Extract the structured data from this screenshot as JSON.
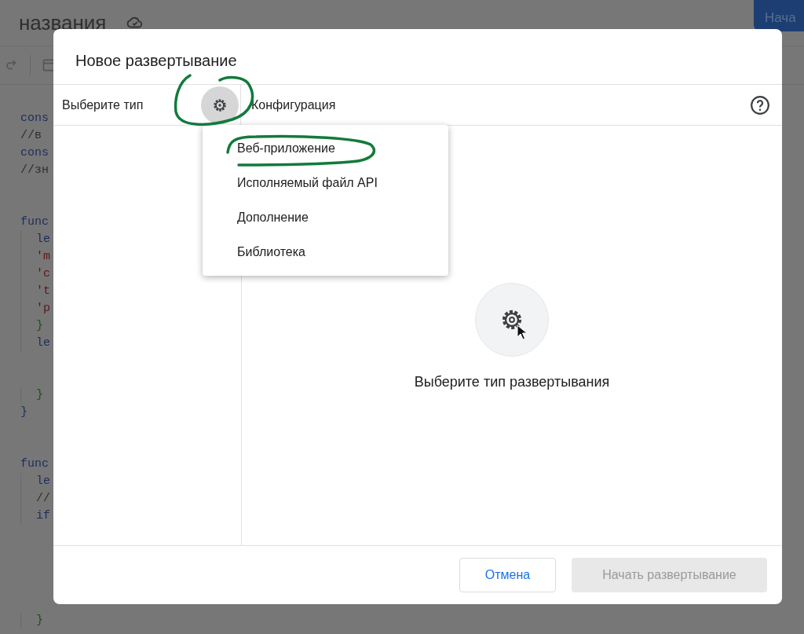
{
  "background": {
    "title": "названия",
    "primary_button": "Нача",
    "code_blocks": [
      [
        {
          "text": "cons",
          "kind": "keyword"
        },
        {
          "text": "//в",
          "kind": "comment"
        },
        {
          "text": "cons",
          "kind": "keyword"
        },
        {
          "text": "//зн",
          "kind": "comment"
        }
      ],
      [
        {
          "text": "func",
          "kind": "keyword",
          "children": [
            [
              {
                "text": "le",
                "kind": "keyword"
              },
              {
                "text": "'m",
                "kind": "string"
              },
              {
                "text": "'c",
                "kind": "string"
              },
              {
                "text": "'t",
                "kind": "string"
              },
              {
                "text": "'p",
                "kind": "string"
              },
              {
                "text": "}",
                "kind": "brace"
              },
              {
                "text": "le",
                "kind": "keyword"
              }
            ],
            [
              {
                "text": "}",
                "kind": "brace"
              }
            ]
          ]
        },
        {
          "text": "}",
          "kind": "keyword"
        }
      ],
      [
        {
          "text": "func",
          "kind": "keyword",
          "children": [
            [
              {
                "text": "le",
                "kind": "keyword"
              },
              {
                "text": "//",
                "kind": "comment"
              },
              {
                "text": "if",
                "kind": "keyword"
              }
            ]
          ]
        }
      ]
    ],
    "bottom_lines": [
      {
        "text": "}",
        "kind": "brace"
      }
    ]
  },
  "dialog": {
    "title": "Новое развертывание",
    "left_header": "Выберите тип",
    "right_header": "Конфигурация",
    "menu": [
      {
        "label": "Веб-приложение",
        "selected": false
      },
      {
        "label": "Исполняемый файл API",
        "selected": false
      },
      {
        "label": "Дополнение",
        "selected": false
      },
      {
        "label": "Библиотека",
        "selected": false
      }
    ],
    "empty_message": "Выберите тип развертывания",
    "buttons": [
      {
        "label": "Отмена",
        "kind": "secondary",
        "disabled": false
      },
      {
        "label": "Начать развертывание",
        "kind": "primary",
        "disabled": true
      }
    ]
  }
}
